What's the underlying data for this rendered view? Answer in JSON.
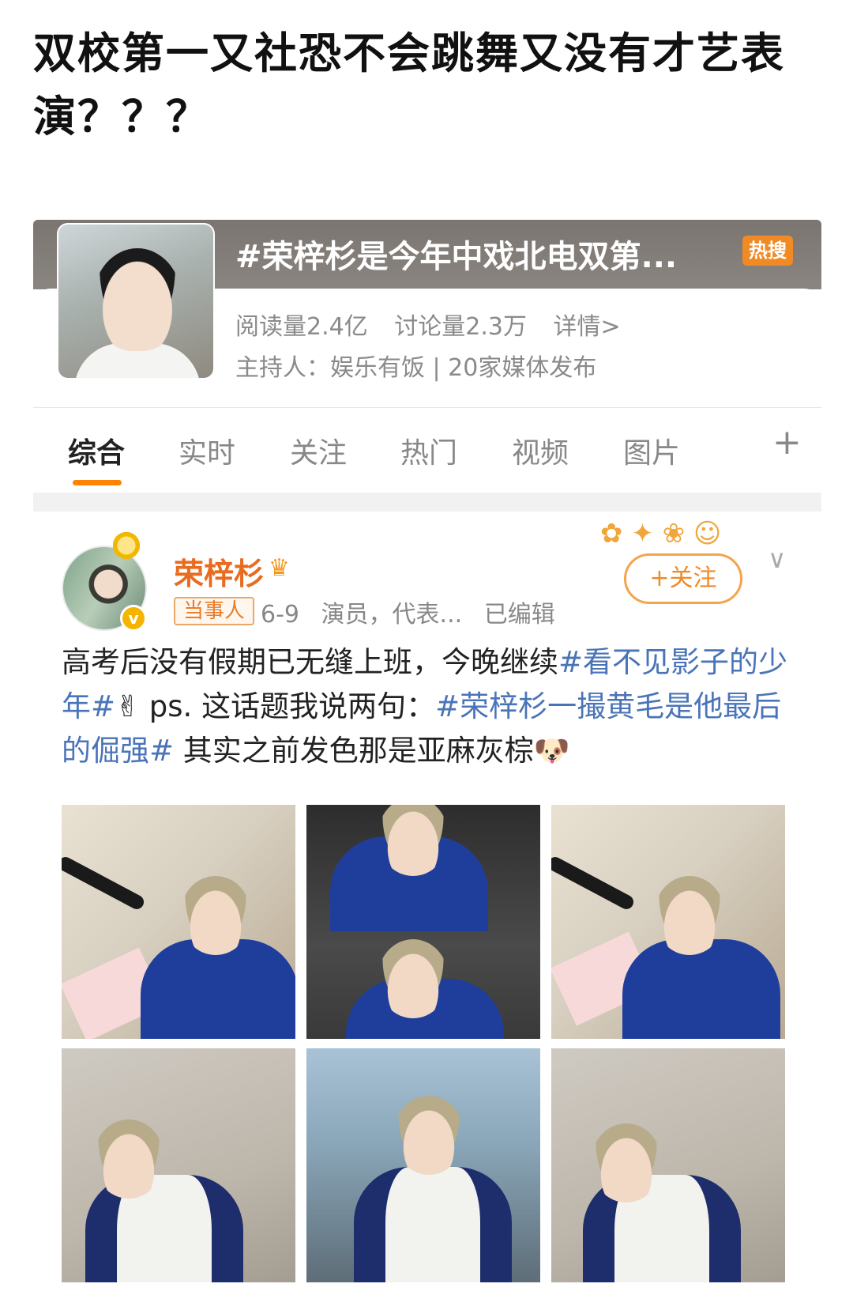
{
  "headline": "双校第一又社恐不会跳舞又没有才艺表演？？？",
  "topic": {
    "title": "#荣梓杉是今年中戏北电双第...",
    "badge": "热搜",
    "reads": "阅读量2.4亿",
    "discussions": "讨论量2.3万",
    "details": "详情>",
    "host": "主持人：娱乐有饭 | 20家媒体发布"
  },
  "tabs": [
    "综合",
    "实时",
    "关注",
    "热门",
    "视频",
    "图片"
  ],
  "tab_more": "+",
  "post": {
    "username": "荣梓杉",
    "verify_mark": "v",
    "role_tag": "当事人",
    "date": "6-9",
    "profession": "演员，代表...",
    "edited": "已编辑",
    "follow_label": "+关注",
    "chevron": "∨",
    "text_1": "高考后没有假期已无缝上班，今晚继续",
    "hashtag_1": "#看不见影子的少年#",
    "text_2": "✌ ps. 这话题我说两句：",
    "hashtag_2": "#荣梓杉一撮黄毛是他最后的倔强#",
    "text_3": " 其实之前发色那是亚麻灰棕🐶"
  },
  "icons": {
    "crown": "crown-icon",
    "follow_decoration": "flower-decoration-icon"
  },
  "colors": {
    "accent_orange": "#ff8200",
    "hashtag_blue": "#4a74b8",
    "username_orange": "#e86b1f",
    "hot_badge": "#f08a24"
  }
}
